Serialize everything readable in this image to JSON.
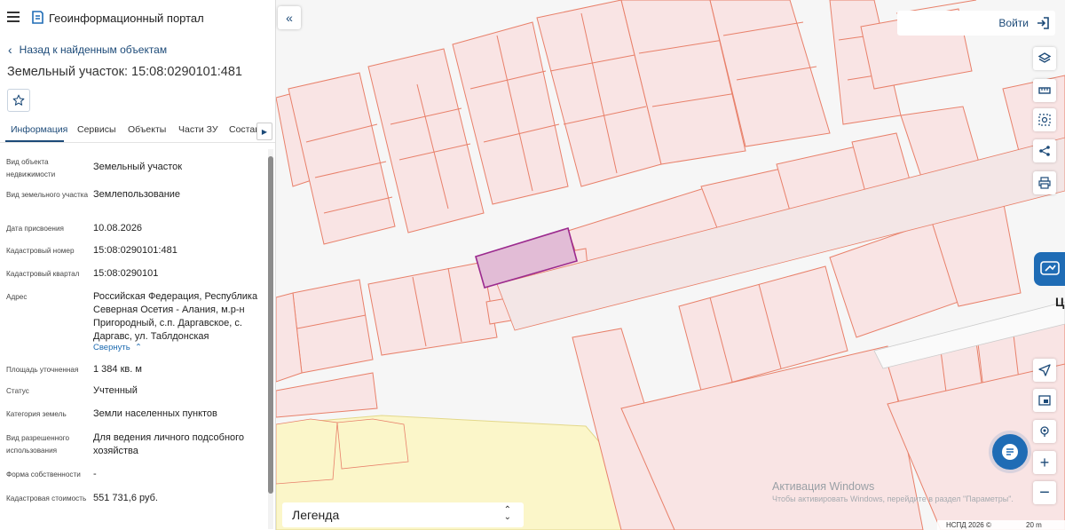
{
  "app": {
    "title": "Геоинформационный портал"
  },
  "nav": {
    "back_label": "Назад к найденным объектам"
  },
  "object": {
    "title": "Земельный участок: 15:08:0290101:481"
  },
  "tabs": [
    {
      "label": "Информация",
      "active": true
    },
    {
      "label": "Сервисы"
    },
    {
      "label": "Объекты"
    },
    {
      "label": "Части ЗУ"
    },
    {
      "label": "Состав"
    }
  ],
  "properties": [
    {
      "label": "Вид объекта недвижимости",
      "value": "Земельный участок"
    },
    {
      "label": "Вид земельного участка",
      "value": "Землепользование"
    },
    {
      "label": "Дата присвоения",
      "value": "10.08.2026"
    },
    {
      "label": "Кадастровый номер",
      "value": "15:08:0290101:481"
    },
    {
      "label": "Кадастровый квартал",
      "value": "15:08:0290101"
    },
    {
      "label": "Адрес",
      "value": "Российская Федерация, Республика Северная Осетия - Алания, м.р-н Пригородный, с.п. Даргавское, с. Даргавс, ул. Таблдонская",
      "toggle": "Свернуть"
    },
    {
      "label": "Площадь уточненная",
      "value": "1 384 кв. м"
    },
    {
      "label": "Статус",
      "value": "Учтенный"
    },
    {
      "label": "Категория земель",
      "value": "Земли населенных пунктов"
    },
    {
      "label": "Вид разрешенного использования",
      "value": "Для ведения личного подсобного хозяйства"
    },
    {
      "label": "Форма собственности",
      "value": "-"
    },
    {
      "label": "Кадастровая стоимость",
      "value": "551 731,6 руб."
    }
  ],
  "map": {
    "login_label": "Войти",
    "legend_label": "Легенда",
    "road_label": "Ц",
    "watermark_title": "Активация Windows",
    "watermark_text": "Чтобы активировать Windows, перейдите в раздел \"Параметры\".",
    "copyright": "НСПД 2026 ©",
    "scale": "20 m",
    "colors": {
      "parcel_fill": "#f9e4e4",
      "parcel_stroke": "#e8806a",
      "selected_fill": "#e2bcd6",
      "selected_stroke": "#9b2a8e",
      "zone_fill": "#fbf6c9",
      "accent": "#1f6cb5"
    }
  },
  "icons": {
    "menu": "menu-icon",
    "logo": "portal-logo-icon",
    "favorite": "star-icon",
    "tools": [
      "layers-icon",
      "ruler-icon",
      "select-area-icon",
      "share-icon",
      "print-icon"
    ],
    "controls": [
      "locate-icon",
      "map-type-icon",
      "geolocation-icon",
      "zoom-in-icon",
      "zoom-out-icon"
    ],
    "chat": "chat-icon"
  }
}
